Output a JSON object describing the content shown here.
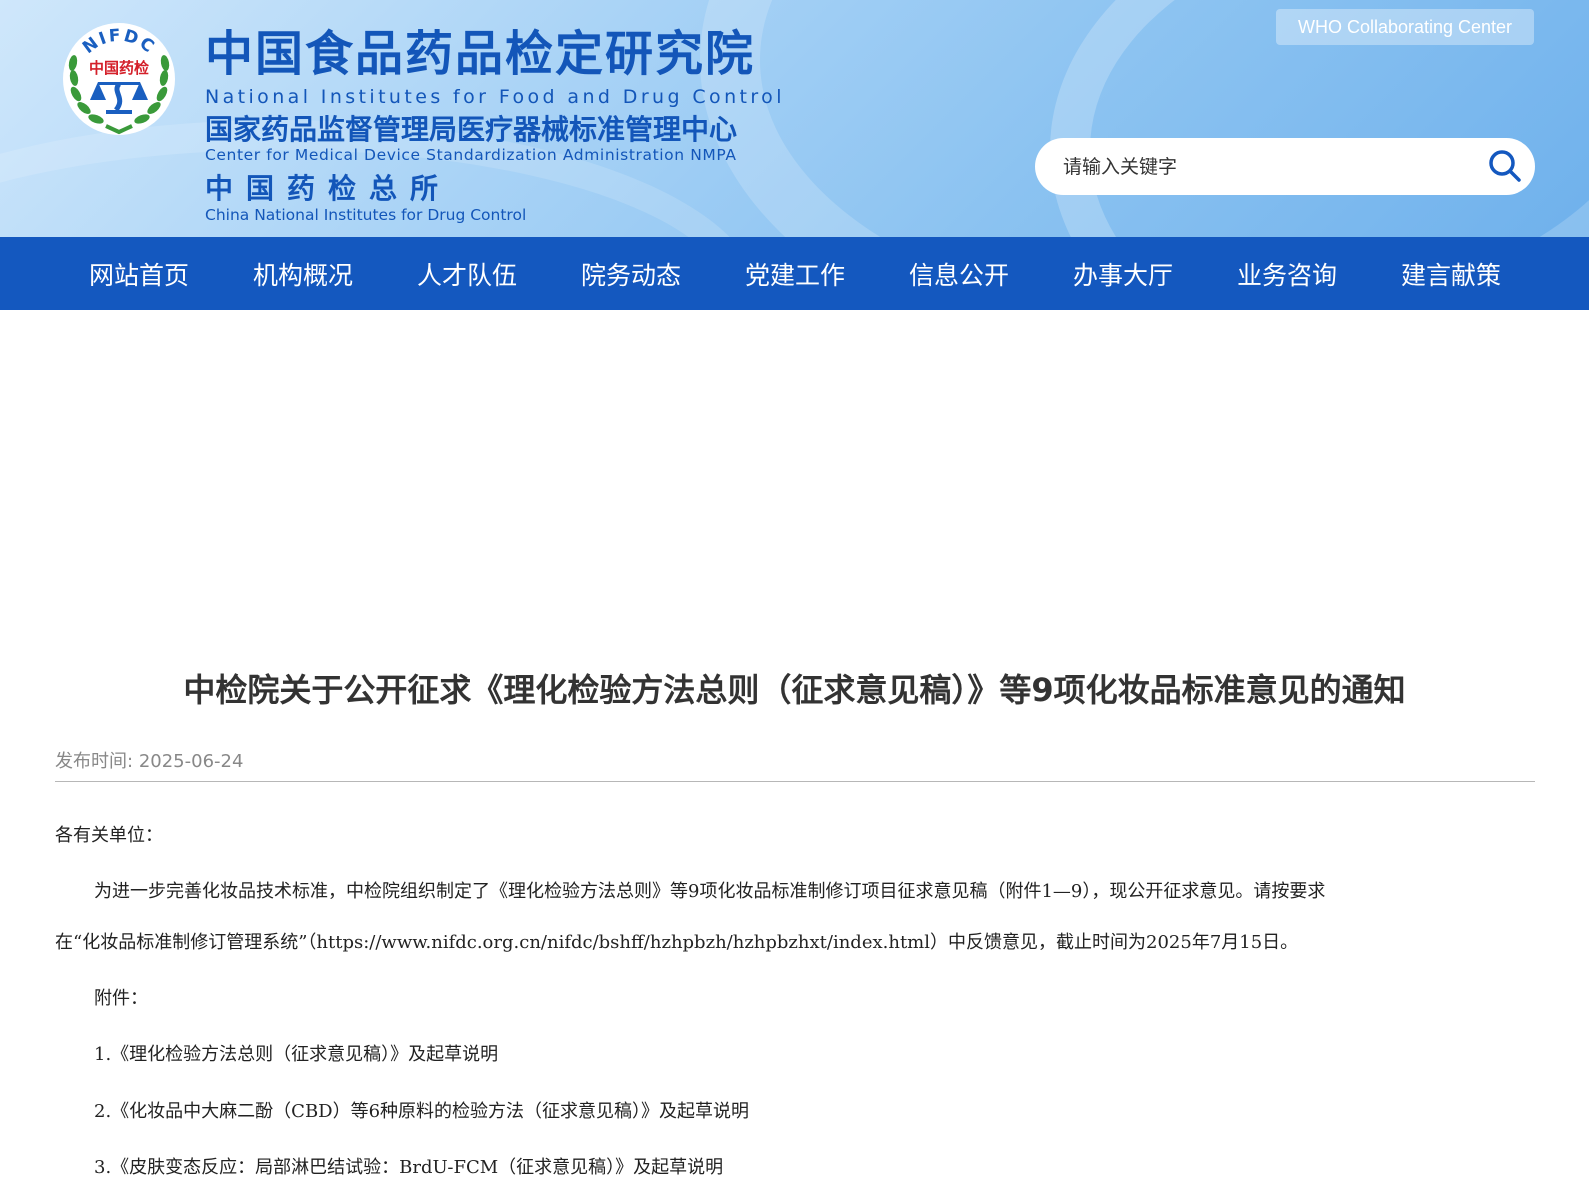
{
  "header": {
    "logo_text": "NIFDC",
    "logo_cn": "中国药检",
    "title_cn": "中国食品药品检定研究院",
    "title_en": "National Institutes for Food and Drug Control",
    "sub1_cn": "国家药品监督管理局医疗器械标准管理中心",
    "sub1_en": "Center for Medical Device Standardization Administration NMPA",
    "sub2_cn": "中国药检总所",
    "sub2_en": "China National Institutes for Drug Control",
    "who_button": "WHO Collaborating Center",
    "search_placeholder": "请输入关键字",
    "search_icon": "search-icon",
    "colors": {
      "brand_blue": "#1356b9",
      "nav_blue": "#1458bf"
    }
  },
  "nav": {
    "items": [
      "网站首页",
      "机构概况",
      "人才队伍",
      "院务动态",
      "党建工作",
      "信息公开",
      "办事大厅",
      "业务咨询",
      "建言献策"
    ]
  },
  "article": {
    "title": "中检院关于公开征求《理化检验方法总则（征求意见稿）》等9项化妆品标准意见的通知",
    "publish_label": "发布时间:",
    "publish_date": "2025-06-24",
    "salutation": "各有关单位：",
    "para1_line1": "为进一步完善化妆品技术标准，中检院组织制定了《理化检验方法总则》等9项化妆品标准制修订项目征求意见稿（附件1—9），现公开征求意见。请按要求",
    "para1_line2": "在“化妆品标准制修订管理系统”（https://www.nifdc.org.cn/nifdc/bshff/hzhpbzh/hzhpbzhxt/index.html）中反馈意见，截止时间为2025年7月15日。",
    "attach_label": "附件：",
    "attachments": [
      "1.《理化检验方法总则（征求意见稿）》及起草说明",
      "2.《化妆品中大麻二酚（CBD）等6种原料的检验方法（征求意见稿）》及起草说明",
      "3.《皮肤变态反应：局部淋巴结试验：BrdU-FCM（征求意见稿）》及起草说明"
    ]
  }
}
